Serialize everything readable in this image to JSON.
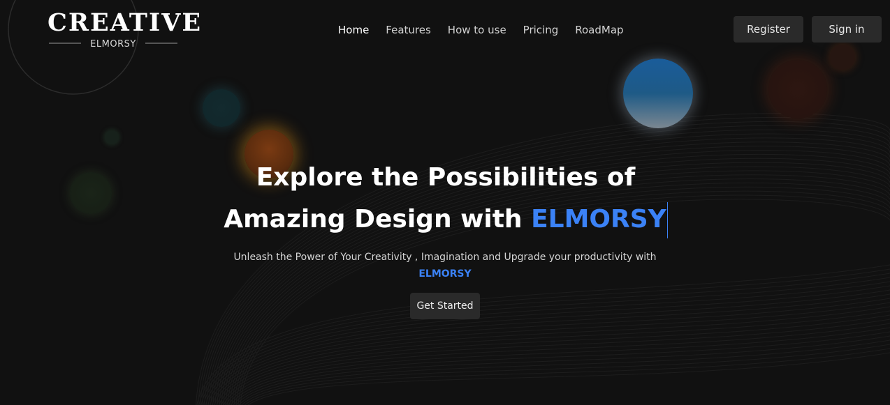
{
  "logo": {
    "title": "CREATIVE",
    "subtitle": "ELMORSY"
  },
  "nav": {
    "items": [
      {
        "label": "Home",
        "active": true
      },
      {
        "label": "Features"
      },
      {
        "label": "How to use"
      },
      {
        "label": "Pricing"
      },
      {
        "label": "RoadMap"
      }
    ]
  },
  "auth": {
    "register_label": "Register",
    "signin_label": "Sign in"
  },
  "hero": {
    "title_line1": "Explore the Possibilities of",
    "title_line2_prefix": "Amazing Design with ",
    "title_line2_accent": "ELMORSY",
    "subtitle_text": "Unleash the Power of Your Creativity , Imagination and Upgrade your productivity with",
    "subtitle_accent": "ELMORSY",
    "cta_label": "Get Started"
  },
  "colors": {
    "background": "#111111",
    "accent": "#3b82f6",
    "button_bg": "#2a2a2a"
  }
}
